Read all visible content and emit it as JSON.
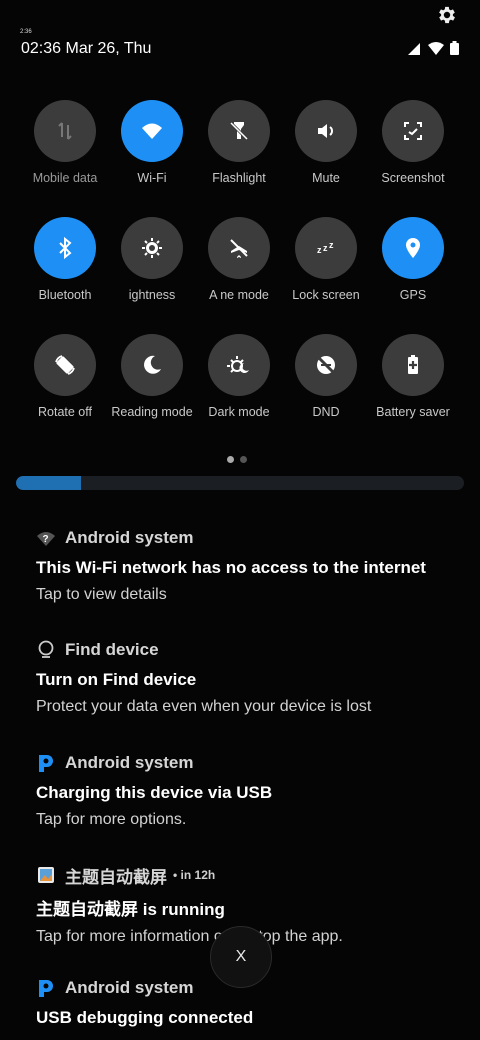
{
  "status": {
    "tiny_time": "2:36",
    "datetime": "02:36 Mar 26, Thu"
  },
  "icons": {
    "settings": "gear-icon",
    "signal": "signal-icon",
    "wifi": "wifi-icon",
    "battery": "battery-icon"
  },
  "colors": {
    "active_tile": "#1e90f5",
    "inactive_tile": "#3c3c3c",
    "progress": "#1f6fb3"
  },
  "quick_settings": [
    {
      "label": "Mobile data",
      "active": false,
      "icon": "mobile-data-icon"
    },
    {
      "label": "Wi-Fi",
      "active": true,
      "icon": "wifi-icon"
    },
    {
      "label": "Flashlight",
      "active": false,
      "icon": "flashlight-icon"
    },
    {
      "label": "Mute",
      "active": false,
      "icon": "volume-icon"
    },
    {
      "label": "Screenshot",
      "active": false,
      "icon": "screenshot-icon"
    },
    {
      "label": "Bluetooth",
      "active": true,
      "icon": "bluetooth-icon"
    },
    {
      "label": "ightness",
      "active": false,
      "icon": "brightness-icon"
    },
    {
      "label": "A   ne mode",
      "active": false,
      "icon": "airplane-icon"
    },
    {
      "label": "Lock screen",
      "active": false,
      "icon": "sleep-icon"
    },
    {
      "label": "GPS",
      "active": true,
      "icon": "location-icon"
    },
    {
      "label": "Rotate off",
      "active": false,
      "icon": "rotate-icon"
    },
    {
      "label": "Reading mode",
      "active": false,
      "icon": "moon-icon"
    },
    {
      "label": "Dark mode",
      "active": false,
      "icon": "dark-mode-icon"
    },
    {
      "label": "DND",
      "active": false,
      "icon": "dnd-icon"
    },
    {
      "label": "Battery saver",
      "active": false,
      "icon": "battery-saver-icon"
    }
  ],
  "pager": {
    "pages": 2,
    "current": 1
  },
  "progress": {
    "fraction": 0.145
  },
  "notifications": [
    {
      "app": "Android system",
      "title": "This Wi-Fi network has no access to the internet",
      "text": "Tap to view details",
      "icon": "wifi-question-icon"
    },
    {
      "app": "Find device",
      "title": "Turn on Find device",
      "text": "Protect your data even when your device is lost",
      "icon": "find-device-icon"
    },
    {
      "app": "Android system",
      "title": "Charging this device via USB",
      "text": "Tap for more options.",
      "icon": "android-system-icon"
    },
    {
      "app": "主题自动截屏",
      "meta": "• in 12h",
      "title": "主题自动截屏 is running",
      "text": "Tap for more information or to stop the app.",
      "icon": "app-icon"
    },
    {
      "app": "Android system",
      "title": "USB debugging connected",
      "text": "",
      "icon": "android-system-icon"
    }
  ],
  "close_button": {
    "label": "X"
  }
}
